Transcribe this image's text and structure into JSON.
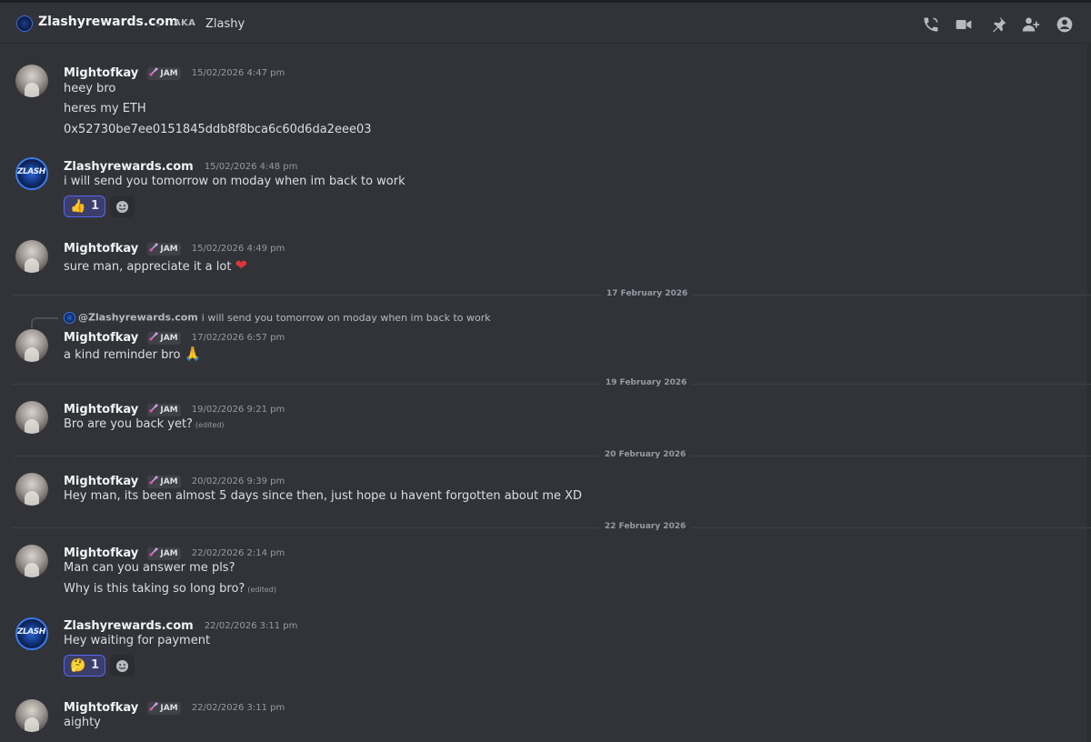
{
  "channel": {
    "name": "Zlashyrewards.com",
    "aka_label": "AKA",
    "nickname": "Zlashy"
  },
  "toolbar_icons": [
    "call-icon",
    "video-icon",
    "pin-icon",
    "add-friend-icon",
    "profile-icon"
  ],
  "colors": {
    "background": "#313338",
    "accent": "#5865f2",
    "heart": "#da373c"
  },
  "messages": [
    {
      "author": "Mightofkay",
      "tag": "JAM",
      "timestamp": "15/02/2026 4:47 pm",
      "lines": [
        "heey bro",
        "heres my ETH",
        "0x52730be7ee0151845ddb8f8bca6c60d6da2eee03"
      ]
    },
    {
      "author": "Zlashyrewards.com",
      "timestamp": "15/02/2026 4:48 pm",
      "lines": [
        "i will send you tomorrow on moday when im back to work"
      ],
      "reaction": {
        "emoji": "👍",
        "count": "1"
      }
    },
    {
      "author": "Mightofkay",
      "tag": "JAM",
      "timestamp": "15/02/2026 4:49 pm",
      "lines": [
        "sure man, appreciate it a lot"
      ],
      "trailing_emoji": "❤"
    },
    {
      "author": "Mightofkay",
      "tag": "JAM",
      "timestamp": "17/02/2026 6:57 pm",
      "reply_to": {
        "author": "@Zlashyrewards.com",
        "text": "i will send you tomorrow on moday when im back to work"
      },
      "lines": [
        "a kind reminder bro"
      ],
      "trailing_emoji": "🙏"
    },
    {
      "author": "Mightofkay",
      "tag": "JAM",
      "timestamp": "19/02/2026 9:21 pm",
      "lines": [
        "Bro are you back yet?"
      ],
      "edited_label": "(edited)"
    },
    {
      "author": "Mightofkay",
      "tag": "JAM",
      "timestamp": "20/02/2026 9:39 pm",
      "lines": [
        "Hey man, its been almost 5 days since then, just hope u havent forgotten about me XD"
      ]
    },
    {
      "author": "Mightofkay",
      "tag": "JAM",
      "timestamp": "22/02/2026 2:14 pm",
      "lines": [
        "Man can you answer me pls?",
        "Why is this taking so long bro?"
      ],
      "edited_label": "(edited)"
    },
    {
      "author": "Zlashyrewards.com",
      "timestamp": "22/02/2026 3:11 pm",
      "lines": [
        "Hey waiting for payment"
      ],
      "reaction": {
        "emoji": "🤔",
        "count": "1"
      }
    },
    {
      "author": "Mightofkay",
      "tag": "JAM",
      "timestamp": "22/02/2026 3:11 pm",
      "lines": [
        "aighty"
      ]
    }
  ],
  "dividers": [
    "17 February 2026",
    "19 February 2026",
    "20 February 2026",
    "22 February 2026"
  ]
}
